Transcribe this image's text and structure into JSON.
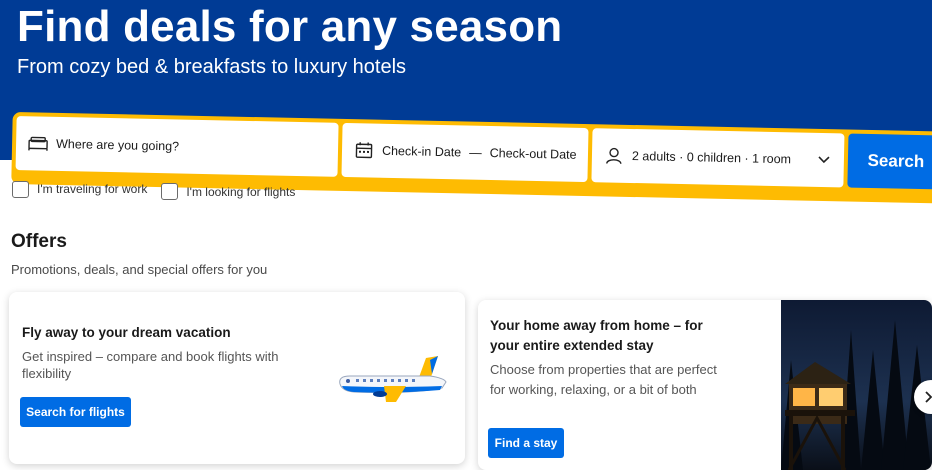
{
  "hero": {
    "title": "Find deals for any season",
    "subtitle": "From cozy bed & breakfasts to luxury hotels"
  },
  "search": {
    "destination_placeholder": "Where are you going?",
    "checkin_label": "Check-in Date",
    "date_separator": "—",
    "checkout_label": "Check-out Date",
    "guests_summary": "2 adults · 0 children · 1 room",
    "search_button": "Search",
    "accent_color": "#febb02"
  },
  "options": {
    "work_travel_label": "I'm traveling for work",
    "flights_label": "I'm looking for flights"
  },
  "offers": {
    "title": "Offers",
    "subtitle": "Promotions, deals, and special offers for you",
    "cards": [
      {
        "title": "Fly away to your dream vacation",
        "description": "Get inspired – compare and book flights with flexibility",
        "button": "Search for flights",
        "image": "airplane-illustration"
      },
      {
        "title": "Your home away from home – for your entire extended stay",
        "description": "Choose from properties that are perfect for working, relaxing, or a bit of both",
        "button": "Find a stay",
        "image": "cabin-at-night-photo"
      }
    ]
  },
  "colors": {
    "brand_blue": "#003b95",
    "button_blue": "#006ce4"
  }
}
